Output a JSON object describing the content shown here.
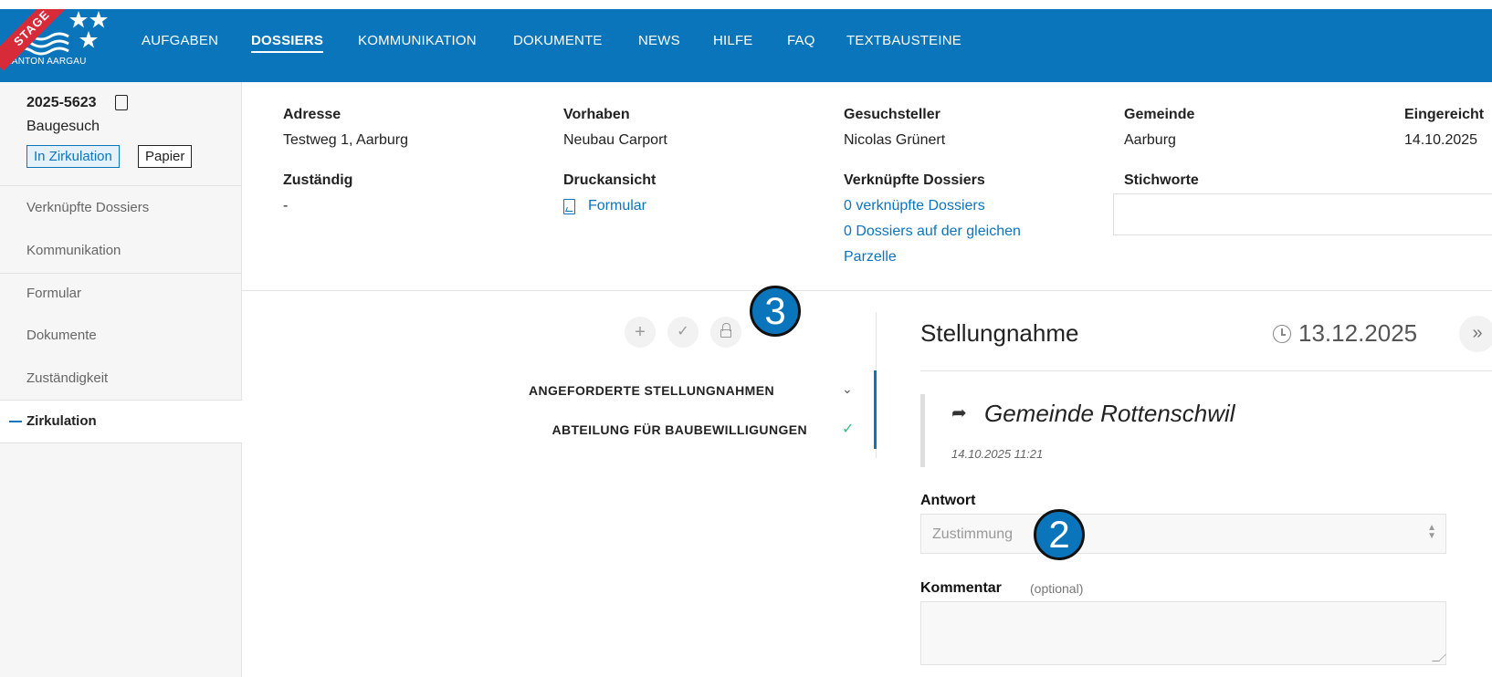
{
  "header": {
    "logo_text": "KANTON AARGAU",
    "stage_label": "STAGE",
    "nav": [
      {
        "label": "AUFGABEN",
        "active": false
      },
      {
        "label": "DOSSIERS",
        "active": true
      },
      {
        "label": "KOMMUNIKATION",
        "active": false
      },
      {
        "label": "DOKUMENTE",
        "active": false
      },
      {
        "label": "NEWS",
        "active": false
      },
      {
        "label": "HILFE",
        "active": false
      },
      {
        "label": "FAQ",
        "active": false
      },
      {
        "label": "TEXTBAUSTEINE",
        "active": false
      }
    ]
  },
  "sidebar": {
    "dossier_id": "2025-5623",
    "dossier_type": "Baugesuch",
    "badges": [
      "In Zirkulation",
      "Papier"
    ],
    "items": [
      {
        "label": "Verknüpfte Dossiers"
      },
      {
        "label": "Kommunikation"
      },
      {
        "label": "Formular"
      },
      {
        "label": "Dokumente"
      },
      {
        "label": "Zuständigkeit"
      },
      {
        "label": "Zirkulation",
        "active": true
      }
    ]
  },
  "info": {
    "adresse_label": "Adresse",
    "adresse_value": "Testweg 1, Aarburg",
    "vorhaben_label": "Vorhaben",
    "vorhaben_value": "Neubau Carport",
    "gesuchsteller_label": "Gesuchsteller",
    "gesuchsteller_value": "Nicolas Grünert",
    "gemeinde_label": "Gemeinde",
    "gemeinde_value": "Aarburg",
    "eingereicht_label": "Eingereicht",
    "eingereicht_value": "14.10.2025",
    "zustaendig_label": "Zuständig",
    "zustaendig_value": "-",
    "druckansicht_label": "Druckansicht",
    "druckansicht_link": "Formular",
    "verknuepfte_label": "Verknüpfte Dossiers",
    "verknuepfte_link": "0 verknüpfte Dossiers",
    "parzelle_link_line1": "0 Dossiers auf der gleichen",
    "parzelle_link_line2": "Parzelle",
    "stichworte_label": "Stichworte"
  },
  "circulation": {
    "buttons": [
      "+",
      "✓",
      "lock"
    ],
    "markers": {
      "three": "3",
      "two": "2"
    },
    "tree": [
      {
        "label": "ANGEFORDERTE STELLUNGNAHMEN",
        "state": "expanded"
      },
      {
        "label": "ABTEILUNG FÜR BAUBEWILLIGUNGEN",
        "state": "done"
      }
    ]
  },
  "panel": {
    "title": "Stellungnahme",
    "deadline": "13.12.2025",
    "more_label": "»",
    "addressee": "Gemeinde Rottenschwil",
    "timestamp": "14.10.2025 11:21",
    "antwort_label": "Antwort",
    "antwort_value": "Zustimmung",
    "kommentar_label": "Kommentar",
    "kommentar_optional": "(optional)",
    "kommentar_value": ""
  },
  "colors": {
    "brand": "#0b75bc",
    "stage": "#d72b3a",
    "success": "#31c27a"
  }
}
